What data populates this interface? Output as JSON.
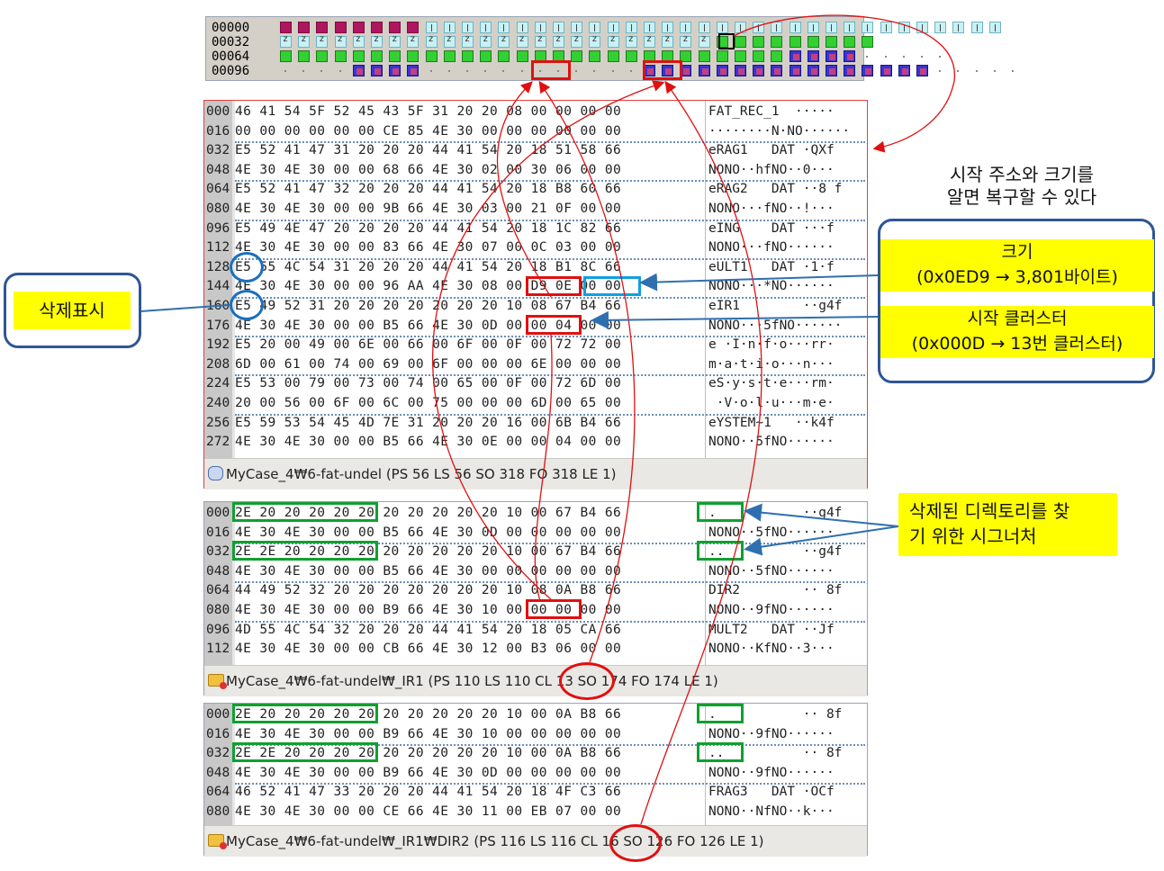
{
  "cluster_map": {
    "rows": [
      {
        "label": "00000",
        "cells": "mmmmmmmmiiiiiiiiiiiiiiiiiiiiiiiiiiiiiiii"
      },
      {
        "label": "00032",
        "cells": "zzzzzzzzzzzzzzzzzzzzzzzzggggggggg"
      },
      {
        "label": "00064",
        "cells": "ggggggggggggggggggggggggggggbbbbddddd"
      },
      {
        "label": "00096",
        "cells": "ddddbbbbddddddddddddbbbbbbbbbbbbbbbbddddd"
      }
    ]
  },
  "panel1": {
    "rows": [
      {
        "off": "000",
        "hex": "46 41 54 5F 52 45 43 5F 31 20 20 08 00 00 00 00",
        "ascii": "FAT_REC_1  ·····"
      },
      {
        "off": "016",
        "hex": "00 00 00 00 00 00 CE 85 4E 30 00 00 00 00 00 00",
        "ascii": "········N·NO······"
      },
      {
        "off": "032",
        "hex": "E5 52 41 47 31 20 20 20 44 41 54 20 18 51 58 66",
        "ascii": "eRAG1   DAT ·QXf"
      },
      {
        "off": "048",
        "hex": "4E 30 4E 30 00 00 68 66 4E 30 02 00 30 06 00 00",
        "ascii": "NONO··hfNO··0···"
      },
      {
        "off": "064",
        "hex": "E5 52 41 47 32 20 20 20 44 41 54 20 18 B8 60 66",
        "ascii": "eRAG2   DAT ··8 f"
      },
      {
        "off": "080",
        "hex": "4E 30 4E 30 00 00 9B 66 4E 30 03 00 21 0F 00 00",
        "ascii": "NONO···fNO··!···"
      },
      {
        "off": "096",
        "hex": "E5 49 4E 47 20 20 20 20 44 41 54 20 18 1C 82 66",
        "ascii": "eING    DAT ···f"
      },
      {
        "off": "112",
        "hex": "4E 30 4E 30 00 00 83 66 4E 30 07 00 0C 03 00 00",
        "ascii": "NONO···fNO······"
      },
      {
        "off": "128",
        "hex": "E5 55 4C 54 31 20 20 20 44 41 54 20 18 B1 8C 66",
        "ascii": "eULT1   DAT ·1·f"
      },
      {
        "off": "144",
        "hex": "4E 30 4E 30 00 00 96 AA 4E 30 08 00 D9 0E 00 00",
        "ascii": "NONO···*NO······"
      },
      {
        "off": "160",
        "hex": "E5 49 52 31 20 20 20 20 20 20 20 10 08 67 B4 66",
        "ascii": "eIR1        ··g4f"
      },
      {
        "off": "176",
        "hex": "4E 30 4E 30 00 00 B5 66 4E 30 0D 00 00 04 00 00",
        "ascii": "NONO···5fNO······"
      },
      {
        "off": "192",
        "hex": "E5 20 00 49 00 6E 00 66 00 6F 00 0F 00 72 72 00",
        "ascii": "e ·I·n·f·o···rr·"
      },
      {
        "off": "208",
        "hex": "6D 00 61 00 74 00 69 00 6F 00 00 00 6E 00 00 00",
        "ascii": "m·a·t·i·o···n···"
      },
      {
        "off": "224",
        "hex": "E5 53 00 79 00 73 00 74 00 65 00 0F 00 72 6D 00",
        "ascii": "eS·y·s·t·e···rm·"
      },
      {
        "off": "240",
        "hex": "20 00 56 00 6F 00 6C 00 75 00 00 00 6D 00 65 00",
        "ascii": " ·V·o·l·u···m·e·"
      },
      {
        "off": "256",
        "hex": "E5 59 53 54 45 4D 7E 31 20 20 20 16 00 6B B4 66",
        "ascii": "eYSTEM~1   ··k4f"
      },
      {
        "off": "272",
        "hex": "4E 30 4E 30 00 00 B5 66 4E 30 0E 00 00 04 00 00",
        "ascii": "NONO··5fNO······"
      }
    ],
    "status": "MyCase_4₩6-fat-undel (PS 56  LS 56  SO 318  FO 318  LE 1)"
  },
  "panel2": {
    "rows": [
      {
        "off": "000",
        "hex": "2E 20 20 20 20 20 20 20 20 20 20 10 00 67 B4 66",
        "ascii": ".           ··g4f"
      },
      {
        "off": "016",
        "hex": "4E 30 4E 30 00 00 B5 66 4E 30 0D 00 00 00 00 00",
        "ascii": "NONO··5fNO······"
      },
      {
        "off": "032",
        "hex": "2E 2E 20 20 20 20 20 20 20 20 20 10 00 67 B4 66",
        "ascii": "..          ··g4f"
      },
      {
        "off": "048",
        "hex": "4E 30 4E 30 00 00 B5 66 4E 30 00 00 00 00 00 00",
        "ascii": "NONO··5fNO······"
      },
      {
        "off": "064",
        "hex": "44 49 52 32 20 20 20 20 20 20 20 10 08 0A B8 66",
        "ascii": "DIR2        ·· 8f"
      },
      {
        "off": "080",
        "hex": "4E 30 4E 30 00 00 B9 66 4E 30 10 00 00 00 00 00",
        "ascii": "NONO··9fNO······"
      },
      {
        "off": "096",
        "hex": "4D 55 4C 54 32 20 20 20 44 41 54 20 18 05 CA 66",
        "ascii": "MULT2   DAT ··Jf"
      },
      {
        "off": "112",
        "hex": "4E 30 4E 30 00 00 CB 66 4E 30 12 00 B3 06 00 00",
        "ascii": "NONO··KfNO··3···"
      }
    ],
    "status": "MyCase_4₩6-fat-undel₩_IR1 (PS 110  LS 110  CL 13  SO 174  FO 174  LE 1)"
  },
  "panel3": {
    "rows": [
      {
        "off": "000",
        "hex": "2E 20 20 20 20 20 20 20 20 20 20 10 00 0A B8 66",
        "ascii": ".           ·· 8f"
      },
      {
        "off": "016",
        "hex": "4E 30 4E 30 00 00 B9 66 4E 30 10 00 00 00 00 00",
        "ascii": "NONO··9fNO······"
      },
      {
        "off": "032",
        "hex": "2E 2E 20 20 20 20 20 20 20 20 20 10 00 0A B8 66",
        "ascii": "..          ·· 8f"
      },
      {
        "off": "048",
        "hex": "4E 30 4E 30 00 00 B9 66 4E 30 0D 00 00 00 00 00",
        "ascii": "NONO··9fNO······"
      },
      {
        "off": "064",
        "hex": "46 52 41 47 33 20 20 20 44 41 54 20 18 4F C3 66",
        "ascii": "FRAG3   DAT ·OCf"
      },
      {
        "off": "080",
        "hex": "4E 30 4E 30 00 00 CE 66 4E 30 11 00 EB 07 00 00",
        "ascii": "NONO··NfNO··k···"
      }
    ],
    "status": "MyCase_4₩6-fat-undel₩_IR1₩DIR2 (PS 116  LS 116  CL 16  SO 126  FO 126  LE 1)"
  },
  "annotations": {
    "deletion_mark": "삭제표시",
    "restore_note_line1": "시작 주소와 크기를",
    "restore_note_line2": "알면 복구할 수 있다",
    "size_title": "크기",
    "size_value": "(0x0ED9 → 3,801바이트)",
    "start_cluster_title": "시작 클러스터",
    "start_cluster_value": "(0x000D → 13번 클러스터)",
    "signature_line1": "삭제된 디렉토리를 찾",
    "signature_line2": "기 위한 시그너처"
  }
}
